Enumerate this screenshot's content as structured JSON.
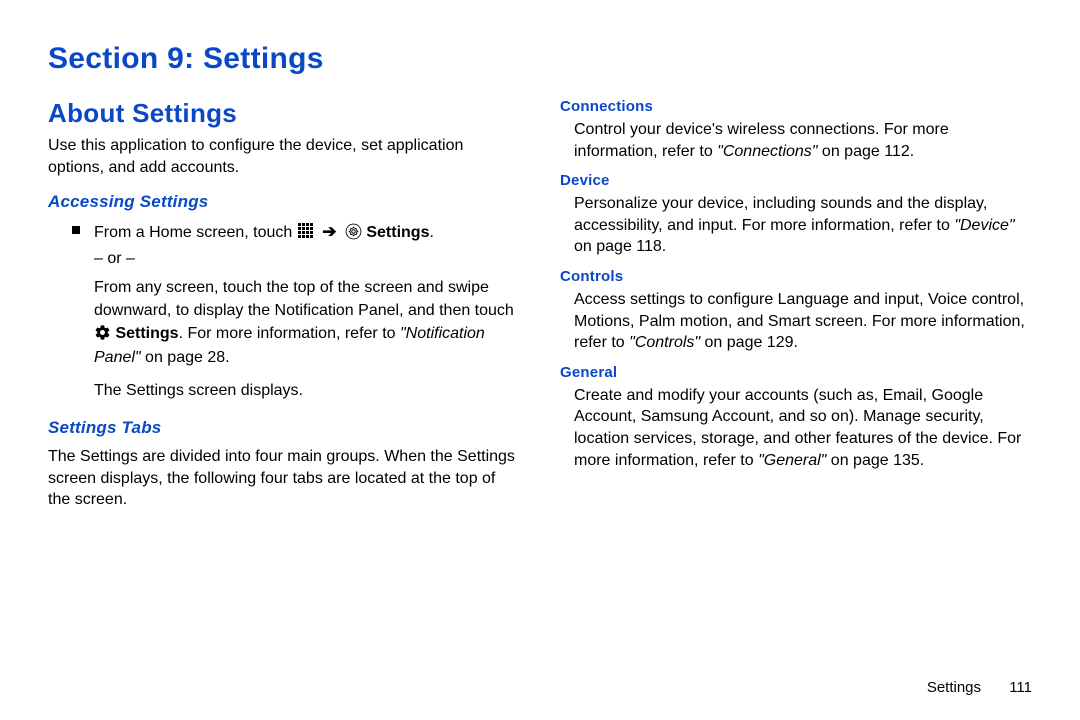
{
  "section_title": "Section 9: Settings",
  "about": {
    "heading": "About Settings",
    "intro": "Use this application to configure the device, set application options, and add accounts."
  },
  "accessing": {
    "heading": "Accessing Settings",
    "line1_prefix": "From a Home screen, touch ",
    "settings_label": "Settings",
    "line1_suffix": ".",
    "or_line": "– or –",
    "para2_a": "From any screen, touch the top of the screen and swipe downward, to display the Notification Panel, and then touch ",
    "settings_label2": "Settings",
    "para2_b": ". For more information, refer to ",
    "ref1": "\"Notification Panel\"",
    "ref1_tail": " on page 28.",
    "para3": "The Settings screen displays."
  },
  "tabs": {
    "heading": "Settings Tabs",
    "intro": "The Settings are divided into four main groups. When the Settings screen displays, the following four tabs are located at the top of the screen.",
    "items": [
      {
        "title": "Connections",
        "body_a": "Control your device's wireless connections. For more information, refer to ",
        "ref": "\"Connections\"",
        "ref_tail": " on page 112."
      },
      {
        "title": "Device",
        "body_a": "Personalize your device, including sounds and the display, accessibility, and input. For more information, refer to ",
        "ref": "\"Device\"",
        "ref_tail": " on page 118."
      },
      {
        "title": "Controls",
        "body_a": "Access settings to configure Language and input, Voice control, Motions, Palm motion, and Smart screen. For more information, refer to ",
        "ref": "\"Controls\"",
        "ref_tail": " on page 129."
      },
      {
        "title": "General",
        "body_a": "Create and modify your accounts (such as, Email, Google Account, Samsung Account, and so on). Manage security, location services, storage, and other features of the device. For more information, refer to ",
        "ref": "\"General\"",
        "ref_tail": " on page 135."
      }
    ]
  },
  "footer": {
    "label": "Settings",
    "page": "111"
  },
  "icons": {
    "apps_grid": "apps-grid-icon",
    "arrow": "arrow-right-icon",
    "gear_outline": "settings-gear-outline-icon",
    "gear_solid": "settings-gear-solid-icon"
  }
}
